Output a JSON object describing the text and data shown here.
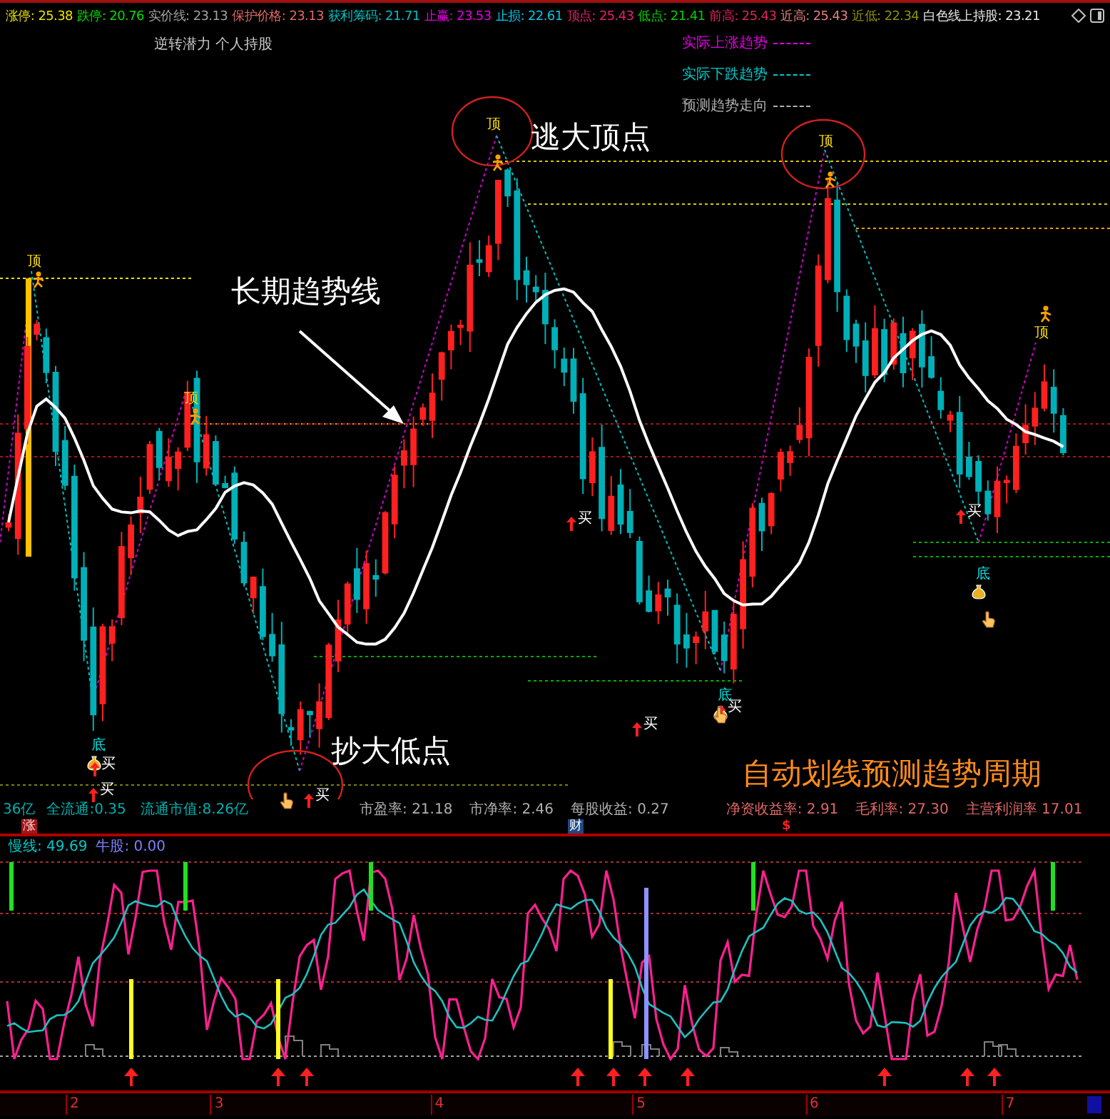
{
  "header": {
    "stats": [
      {
        "text": "涨停: 25.38",
        "color": "#e8e000"
      },
      {
        "text": "跌停: 20.76",
        "color": "#00e000"
      },
      {
        "text": "实价线: 23.13",
        "color": "#a0a0a0"
      },
      {
        "text": "保护价格: 23.13",
        "color": "#e06868"
      },
      {
        "text": "获利筹码: 21.71",
        "color": "#00c0c0"
      },
      {
        "text": "止赢: 23.53",
        "color": "#e000e0"
      },
      {
        "text": "止损: 22.61",
        "color": "#00c8e8"
      },
      {
        "text": "顶点: 25.43",
        "color": "#e8206a"
      },
      {
        "text": "低点: 21.41",
        "color": "#00d000"
      },
      {
        "text": "前高: 25.43",
        "color": "#e02060"
      },
      {
        "text": "近高: 25.43",
        "color": "#e08080"
      },
      {
        "text": "近低: 22.34",
        "color": "#909000"
      },
      {
        "text": "白色线上持股: 23.21",
        "color": "#e8e8e8"
      }
    ]
  },
  "chart": {
    "subtitle": "逆转潜力 个人持股",
    "legend": [
      {
        "label": "实际上涨趋势",
        "color": "#e000e0"
      },
      {
        "label": "实际下跌趋势",
        "color": "#00c8c8"
      },
      {
        "label": "预测趋势走向",
        "color": "#b0b0b0"
      }
    ],
    "annotations": [
      {
        "text": "逃大顶点",
        "kind": "note"
      },
      {
        "text": "长期趋势线",
        "kind": "note"
      },
      {
        "text": "抄大低点",
        "kind": "note"
      },
      {
        "text": "自动划线预测趋势周期",
        "kind": "headline"
      }
    ],
    "markers": [
      {
        "kind": "top",
        "label": "顶"
      },
      {
        "kind": "top",
        "label": "顶"
      },
      {
        "kind": "top",
        "label": "顶"
      },
      {
        "kind": "top",
        "label": "顶"
      },
      {
        "kind": "top",
        "label": "顶"
      },
      {
        "kind": "bottom",
        "label": "底"
      },
      {
        "kind": "bottom",
        "label": "底"
      },
      {
        "kind": "bottom",
        "label": "底"
      },
      {
        "kind": "buy",
        "label": "买"
      },
      {
        "kind": "buy",
        "label": "买"
      },
      {
        "kind": "buy",
        "label": "买"
      },
      {
        "kind": "buy",
        "label": "买"
      },
      {
        "kind": "buy",
        "label": "买"
      },
      {
        "kind": "buy",
        "label": "买"
      },
      {
        "kind": "buy",
        "label": "买"
      }
    ]
  },
  "fundamentals": {
    "items": [
      {
        "text": "36亿",
        "color": "#00b0b0"
      },
      {
        "text": "全流通:0.35",
        "color": "#00b0b0"
      },
      {
        "text": "流通市值:8.26亿",
        "color": "#00b0b0"
      },
      {
        "text": "市盈率: 21.18",
        "color": "#b0b0b0"
      },
      {
        "text": "市净率: 2.46",
        "color": "#b0b0b0"
      },
      {
        "text": "每股收益: 0.27",
        "color": "#b0b0b0"
      },
      {
        "text": "净资收益率: 2.91",
        "color": "#e06868"
      },
      {
        "text": "毛利率: 27.30",
        "color": "#e06868"
      },
      {
        "text": "主营利润率 17.01",
        "color": "#e06868"
      }
    ],
    "badges": [
      {
        "kind": "rise",
        "text": "涨"
      },
      {
        "kind": "finance",
        "text": "财"
      },
      {
        "kind": "dollar",
        "text": "$"
      }
    ]
  },
  "indicator": {
    "readings": [
      {
        "text": "慢线: 49.69",
        "color": "#00c8c8"
      },
      {
        "text": "牛股: 0.00",
        "color": "#8080ff"
      }
    ]
  },
  "time_axis": {
    "labels": [
      "2",
      "3",
      "4",
      "5",
      "6",
      "7"
    ]
  }
}
